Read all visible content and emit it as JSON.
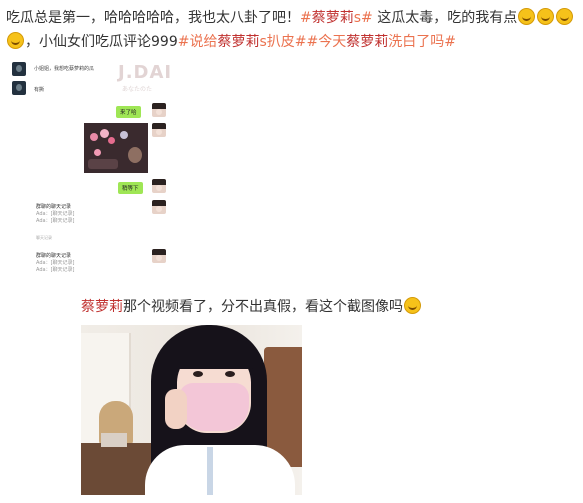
{
  "post": {
    "part1": "吃瓜总是第一，哈哈哈哈哈，我也太八卦了吧！",
    "tag1_hash_open": "#",
    "tag1_name": "蔡萝莉",
    "tag1_rest": "s#",
    "part2": " 这瓜太毒，吃的我有点",
    "part3": "，小仙女们吃瓜评论999",
    "tag2": "#说给",
    "tag2_name": "蔡萝莉",
    "tag2_rest": "s扒皮#",
    "tag3": "#今天",
    "tag3_name": "蔡萝莉",
    "tag3_rest": "洗白了吗#"
  },
  "chat": {
    "watermark": "J.DAI",
    "watermark_sub": "あなたのた",
    "msg1": "小姐姐，我想吃蔡萝莉的瓜",
    "msg2": "有撕",
    "bubble1": "来了哈",
    "bubble2": "稍等下",
    "record1_title": "群聊的聊天记录",
    "record1_lines": [
      "Ada：[聊天记录]",
      "Ada：[聊天记录]"
    ],
    "record1_footer": "聊天记录",
    "record2_title": "群聊的聊天记录",
    "record2_lines": [
      "Ada：[聊天记录]",
      "Ada：[聊天记录]"
    ]
  },
  "caption": {
    "name": "蔡萝莉",
    "text": "那个视频看了，分不出真假，看这个截图像吗"
  },
  "icons": [
    "laugh-cry-emoji",
    "laugh-cry-emoji",
    "laugh-cry-emoji",
    "laugh-cry-emoji",
    "sweat-smile-emoji"
  ],
  "colors": {
    "tag": "#eb7350",
    "name_highlight": "#c0312f",
    "chat_bubble": "#9fe655"
  }
}
